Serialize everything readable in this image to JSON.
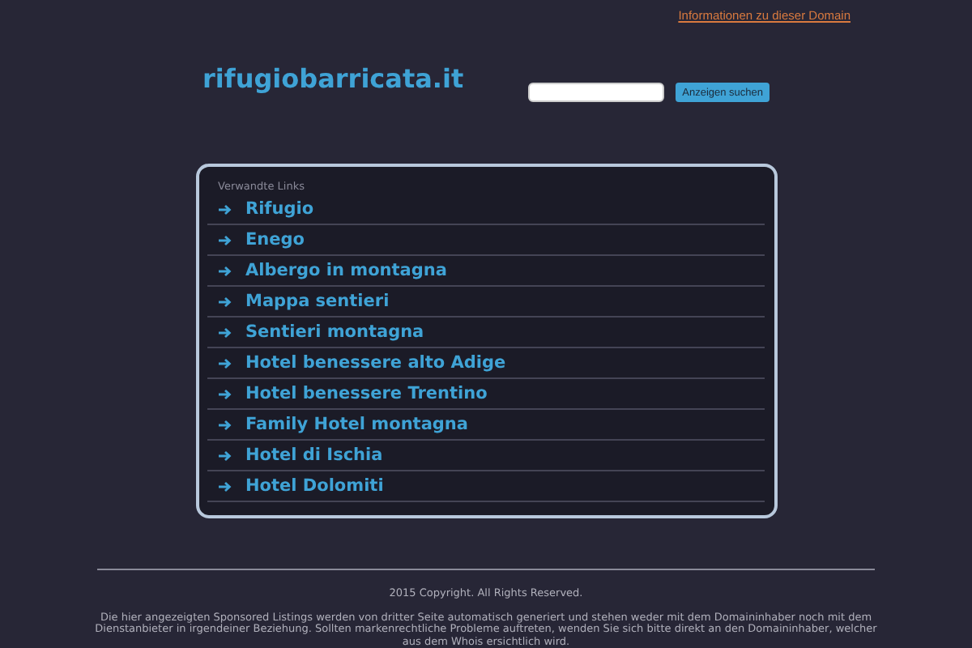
{
  "header": {
    "info_link": "Informationen zu dieser Domain",
    "site_title": "rifugiobarricata.it",
    "search_button": "Anzeigen suchen"
  },
  "links_panel": {
    "heading": "Verwandte Links",
    "links": [
      {
        "label": "Rifugio"
      },
      {
        "label": "Enego"
      },
      {
        "label": "Albergo in montagna"
      },
      {
        "label": "Mappa sentieri"
      },
      {
        "label": "Sentieri montagna"
      },
      {
        "label": "Hotel benessere alto Adige"
      },
      {
        "label": "Hotel benessere Trentino"
      },
      {
        "label": "Family Hotel montagna"
      },
      {
        "label": "Hotel di Ischia"
      },
      {
        "label": "Hotel Dolomiti"
      }
    ]
  },
  "footer": {
    "copyright": "2015 Copyright. All Rights Reserved.",
    "disclaimer": "Die hier angezeigten Sponsored Listings werden von dritter Seite automatisch generiert und stehen weder mit dem Domaininhaber noch mit dem Dienstanbieter in irgendeiner Beziehung. Sollten markenrechtliche Probleme auftreten, wenden Sie sich bitte direkt an den Domaininhaber, welcher aus dem Whois ersichtlich wird."
  }
}
